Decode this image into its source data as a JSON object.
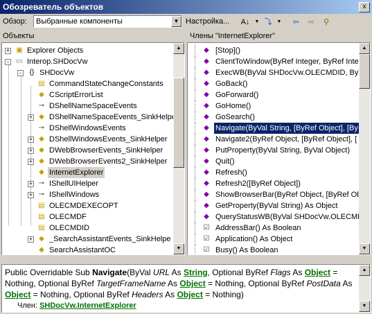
{
  "window": {
    "title": "Обозреватель объектов",
    "close_label": "x"
  },
  "toolbar": {
    "browse_label": "Обзор:",
    "browse_value": "Выбранные компоненты",
    "settings_label": "Настройка..."
  },
  "left_pane": {
    "header": "Объекты",
    "items": [
      {
        "label": "Explorer Objects",
        "icon": "folder-icon",
        "expander": "+"
      },
      {
        "label": "Interop.SHDocVw",
        "icon": "assembly-icon",
        "expander": "-"
      },
      {
        "label": "SHDocVw",
        "icon": "namespace-icon",
        "expander": "-"
      },
      {
        "label": "CommandStateChangeConstants",
        "icon": "enum-icon",
        "expander": ""
      },
      {
        "label": "CScriptErrorList",
        "icon": "class-icon",
        "expander": ""
      },
      {
        "label": "DShellNameSpaceEvents",
        "icon": "interface-icon",
        "expander": ""
      },
      {
        "label": "DShellNameSpaceEvents_SinkHelper",
        "icon": "class-icon",
        "expander": "+"
      },
      {
        "label": "DShellWindowsEvents",
        "icon": "interface-icon",
        "expander": ""
      },
      {
        "label": "DShellWindowsEvents_SinkHelper",
        "icon": "class-icon",
        "expander": "+"
      },
      {
        "label": "DWebBrowserEvents_SinkHelper",
        "icon": "class-icon",
        "expander": "+"
      },
      {
        "label": "DWebBrowserEvents2_SinkHelper",
        "icon": "class-icon",
        "expander": "+"
      },
      {
        "label": "InternetExplorer",
        "icon": "class-icon",
        "expander": ""
      },
      {
        "label": "IShellUIHelper",
        "icon": "interface-icon",
        "expander": "+"
      },
      {
        "label": "IShellWindows",
        "icon": "interface-icon",
        "expander": "+"
      },
      {
        "label": "OLECMDEXECOPT",
        "icon": "enum-icon",
        "expander": ""
      },
      {
        "label": "OLECMDF",
        "icon": "enum-icon",
        "expander": ""
      },
      {
        "label": "OLECMDID",
        "icon": "enum-icon",
        "expander": ""
      },
      {
        "label": "_SearchAssistantEvents_SinkHelpe",
        "icon": "class-icon",
        "expander": "+"
      },
      {
        "label": "SearchAssistantOC",
        "icon": "class-icon",
        "expander": ""
      }
    ]
  },
  "right_pane": {
    "header": "Члены \"InternetExplorer\"",
    "items": [
      {
        "label": "[Stop]()",
        "icon": "method-icon"
      },
      {
        "label": "ClientToWindow(ByRef Integer, ByRef Inte",
        "icon": "method-icon"
      },
      {
        "label": "ExecWB(ByVal SHDocVw.OLECMDID, ByVal",
        "icon": "method-icon"
      },
      {
        "label": "GoBack()",
        "icon": "method-icon"
      },
      {
        "label": "GoForward()",
        "icon": "method-icon"
      },
      {
        "label": "GoHome()",
        "icon": "method-icon"
      },
      {
        "label": "GoSearch()",
        "icon": "method-icon"
      },
      {
        "label": "Navigate(ByVal String, [ByRef Object], [By",
        "icon": "method-icon"
      },
      {
        "label": "Navigate2(ByRef Object, [ByRef Object], [",
        "icon": "method-icon"
      },
      {
        "label": "PutProperty(ByVal String, ByVal Object)",
        "icon": "method-icon"
      },
      {
        "label": "Quit()",
        "icon": "method-icon"
      },
      {
        "label": "Refresh()",
        "icon": "method-icon"
      },
      {
        "label": "Refresh2([ByRef Object])",
        "icon": "method-icon"
      },
      {
        "label": "ShowBrowserBar(ByRef Object, [ByRef Ob",
        "icon": "method-icon"
      },
      {
        "label": "GetProperty(ByVal String) As Object",
        "icon": "method-icon"
      },
      {
        "label": "QueryStatusWB(ByVal SHDocVw.OLECMDII",
        "icon": "method-icon"
      },
      {
        "label": "AddressBar() As Boolean",
        "icon": "property-icon"
      },
      {
        "label": "Application() As Object",
        "icon": "property-icon"
      },
      {
        "label": "Busy() As Boolean",
        "icon": "property-icon"
      }
    ]
  },
  "description": {
    "s1": "Public Overridable Sub ",
    "name": "Navigate",
    "s2": "(ByVal ",
    "p1": "URL",
    "s3": " As ",
    "t1": "String",
    "s4": ", Optional ByRef ",
    "p2": "Flags",
    "s5": " As ",
    "t2": "Object",
    "s6": " = Nothing, Optional ByRef ",
    "p3": "TargetFrameName",
    "s7": " As ",
    "t3": "Object",
    "s8": " = Nothing, Optional ByRef ",
    "p4": "PostData",
    "s9": " As ",
    "t4": "Object",
    "s10": " = Nothing, Optional ByRef ",
    "p5": "Headers",
    "s11": " As ",
    "t5": "Object",
    "s12": " = Nothing)",
    "member_label": "Член: ",
    "member_ns": "SHDocVw",
    "member_dot": ".",
    "member_cls": "InternetExplorer"
  }
}
